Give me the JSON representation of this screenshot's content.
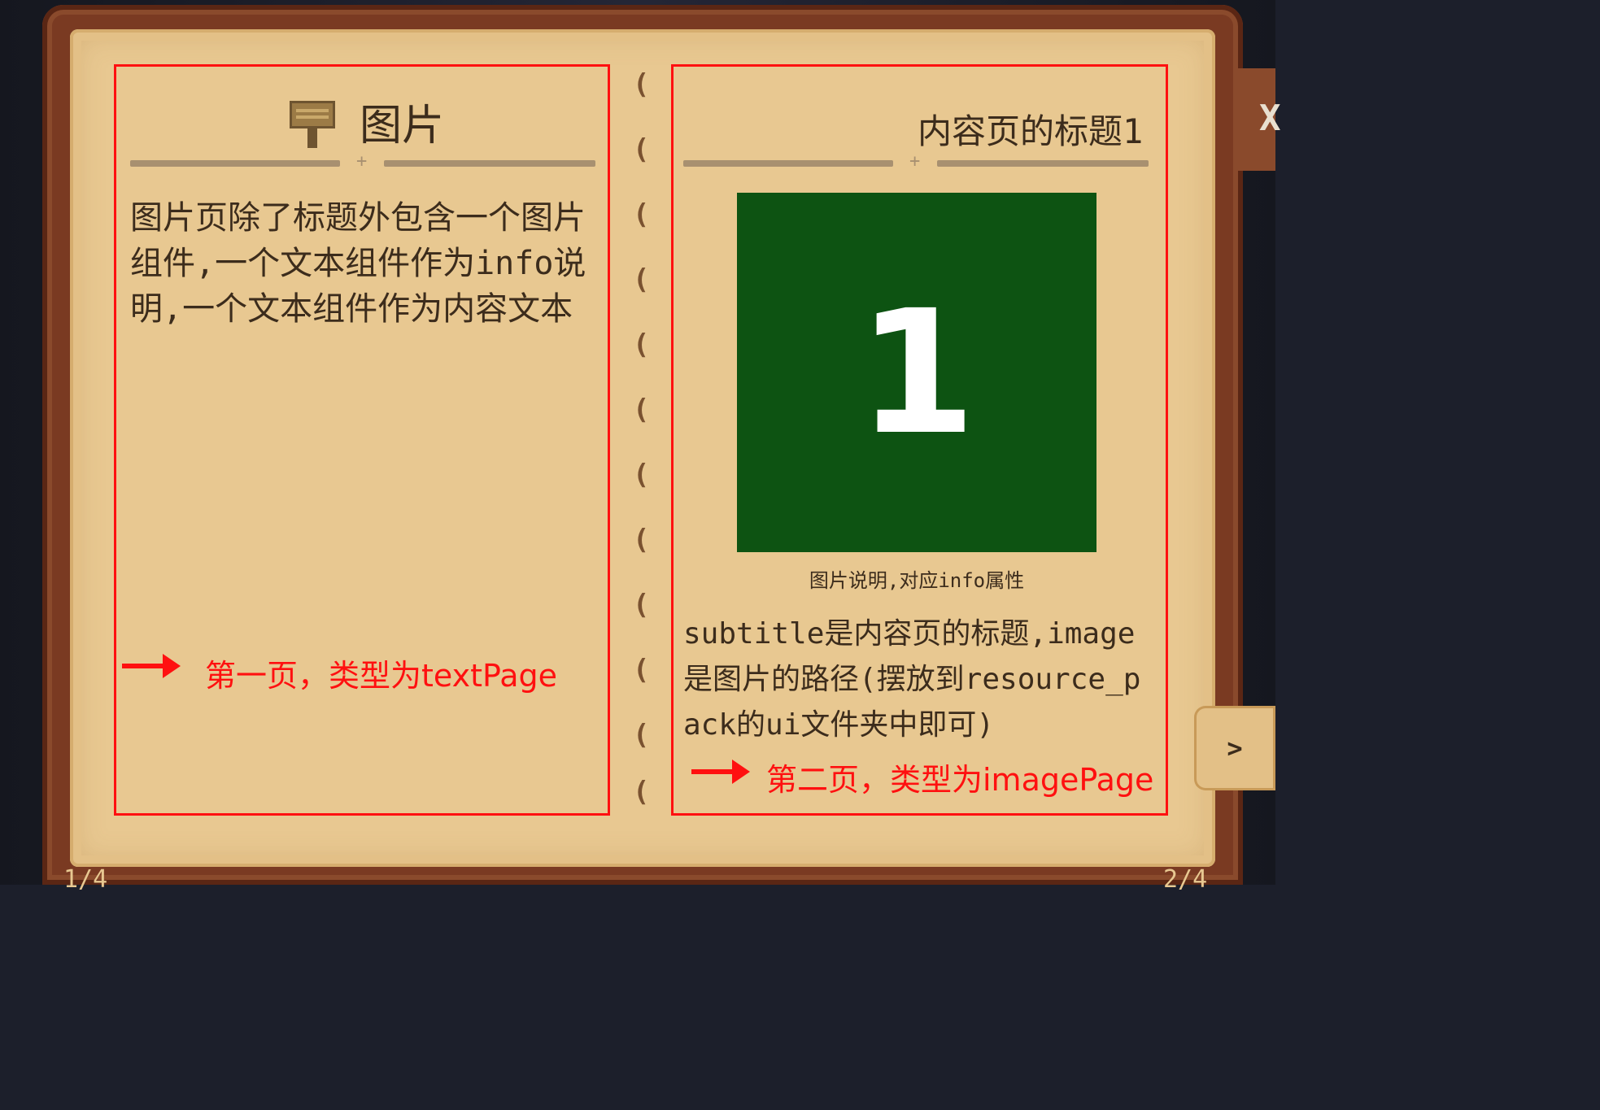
{
  "left_page": {
    "title": "图片",
    "body": "图片页除了标题外包含一个图片组件,一个文本组件作为info说明,一个文本组件作为内容文本",
    "annotation": "第一页，类型为textPage",
    "page_number": "1/4"
  },
  "right_page": {
    "title": "内容页的标题1",
    "image_label": "1",
    "image_color": "#0d5312",
    "caption": "图片说明,对应info属性",
    "body": "subtitle是内容页的标题,image是图片的路径(摆放到resource_pack的ui文件夹中即可)",
    "annotation": "第二页，类型为imagePage",
    "page_number": "2/4"
  },
  "spine_ring_glyph": "(",
  "next_button_glyph": ">",
  "close_button_glyph": "X",
  "icons": {
    "title_icon": "sign-post-icon",
    "next": "chevron-right-icon",
    "close": "close-icon"
  },
  "colors": {
    "annotation": "#ff1010",
    "page": "#e8c891",
    "cover": "#7a3a22"
  }
}
